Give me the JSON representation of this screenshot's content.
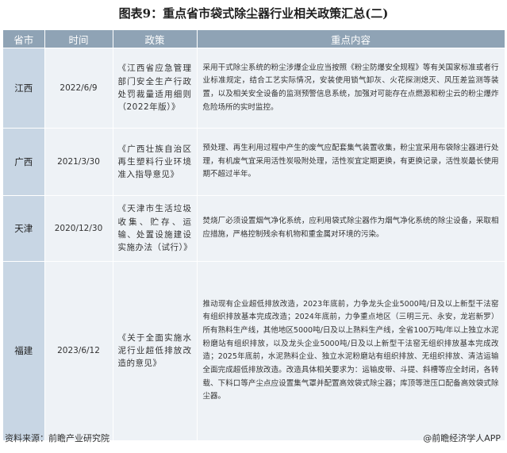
{
  "title": "图表9：重点省市袋式除尘器行业相关政策汇总(二)",
  "headers": {
    "region": "省市",
    "time": "时间",
    "policy": "政策",
    "content": "重点内容"
  },
  "rows": [
    {
      "region": "江西",
      "time": "2022/6/9",
      "policy": "《江西省应急管理部门安全生产行政处罚裁量适用细则（2022年版）》",
      "content": "采用干式除尘系统的粉尘涉爆企业应当按照《粉尘防爆安全规程》等有关国家标准或者行业标准规定，结合工艺实际情况，安装使用锁气卸灰、火花探测熄灭、风压差监测等装置，以及相关安全设备的监测预警信息系统，加强对可能存在点燃源和粉尘云的粉尘爆炸危险场所的实时监控。"
    },
    {
      "region": "广西",
      "time": "2021/3/30",
      "policy": "《广西壮族自治区再生塑料行业环境准入指导意见》",
      "content": "预处理、再生利用过程中产生的废气应配套集气装置收集，粉尘宜采用布袋除尘器进行处理，有机废气宜采用活性炭吸附处理，活性炭宜定期更换，有更换记录，活性炭最长使用期不超过半年。"
    },
    {
      "region": "天津",
      "time": "2020/12/30",
      "policy": "《天津市生活垃圾收集、贮存、运输、处置设施建设实施办法（试行）》",
      "content": "焚烧厂必须设置烟气净化系统，应利用袋式除尘器作为烟气净化系统的除尘设备，采取相应措施，严格控制残余有机物和重金属对环境的污染。"
    },
    {
      "region": "福建",
      "time": "2023/6/12",
      "policy": "《关于全面实施水泥行业超低排放改造的意见》",
      "content": "推动现有企业超低排放改造，2023年底前，力争龙头企业5000吨/日及以上新型干法窑有组织排放基本完成改造；2024年底前，力争重点地区（三明三元、永安，龙岩新罗）所有熟料生产线，其他地区5000吨/日及以上熟料生产线，全省100万吨/年以上独立水泥粉磨站有组织排放，以及龙头企业5000吨/日及以上新型干法窑无组织排放基本完成改造；2025年底前，水泥熟料企业、独立水泥粉磨站有组织排放、无组织排放、清洁运输全面完成超低排放改造。改造具体相关要求为：运输皮带、斗提、斜槽等应全封闭，各转载、下料口等产尘点应设置集气罩并配置高效袋式除尘器；库顶等泄压口配备高效袋式除尘器。"
    }
  ],
  "footer": {
    "source": "资料来源：前瞻产业研究院",
    "brand": "@前瞻经济学人APP"
  }
}
